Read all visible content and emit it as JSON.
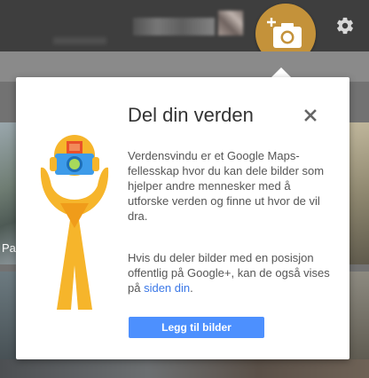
{
  "topbar": {
    "icons": {
      "add_photo": "add-photo-camera-icon",
      "settings": "gear-icon"
    },
    "colors": {
      "background": "#3e3e3e",
      "camera_button": "#c4923a"
    }
  },
  "background": {
    "photo_label": "Pa"
  },
  "dialog": {
    "title": "Del din verden",
    "paragraph1": "Verdensvindu er et Google Maps-fellesskap hvor du kan dele bilder som hjelper andre mennesker med å utforske verden og finne ut hvor de vil dra.",
    "paragraph2_text": "Hvis du deler bilder med en posisjon offentlig på Google+, kan de også vises på ",
    "paragraph2_link": "siden din",
    "paragraph2_end": ".",
    "button_label": "Legg til bilder",
    "icons": {
      "close": "close-icon",
      "illustration": "pegman-camera-illustration-icon"
    },
    "colors": {
      "button": "#4d90fe",
      "link": "#3b78e7",
      "illustration": "#f6b52b"
    }
  }
}
